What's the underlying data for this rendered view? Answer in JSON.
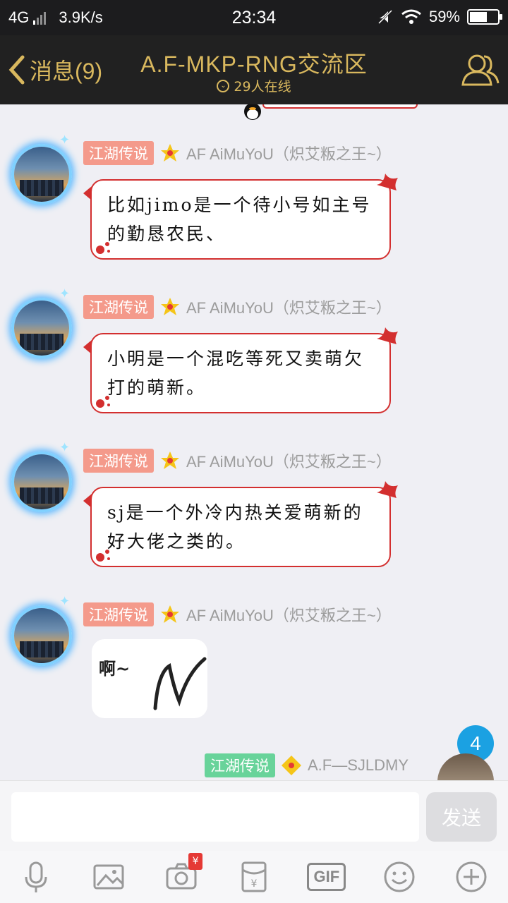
{
  "status": {
    "network": "4G",
    "speed": "3.9K/s",
    "time": "23:34",
    "battery": "59%"
  },
  "header": {
    "back_label": "消息(9)",
    "title": "A.F-MKP-RNG交流区",
    "online": "29人在线"
  },
  "messages": [
    {
      "badge": "江湖传说",
      "nick": "AF AiMuYoU（炽艾粄之王~）",
      "text": "比如jimo是一个待小号如主号的勤恳农民、"
    },
    {
      "badge": "江湖传说",
      "nick": "AF AiMuYoU（炽艾粄之王~）",
      "text": "小明是一个混吃等死又卖萌欠打的萌新。"
    },
    {
      "badge": "江湖传说",
      "nick": "AF AiMuYoU（炽艾粄之王~）",
      "text": "sj是一个外冷内热关爱萌新的好大佬之类的。"
    },
    {
      "badge": "江湖传说",
      "nick": "AF AiMuYoU（炽艾粄之王~）",
      "image_text": "啊~"
    }
  ],
  "self_message": {
    "badge": "江湖传说",
    "nick": "A.F—SJLDMY",
    "unread": "4"
  },
  "input": {
    "send_label": "发送"
  },
  "toolbar": {
    "voice": "mic-icon",
    "image": "image-icon",
    "camera": "camera-icon",
    "redpacket_mark": "¥",
    "redpacket": "red-packet-icon",
    "gif": "GIF",
    "emoji": "emoji-icon",
    "more": "plus-icon"
  },
  "colors": {
    "header_bg": "#212121",
    "accent_gold": "#d9b85e",
    "bubble_border": "#d32f2f",
    "badge_red": "#f49a8b",
    "badge_green": "#68d39a",
    "unread_blue": "#1ba1e2"
  }
}
